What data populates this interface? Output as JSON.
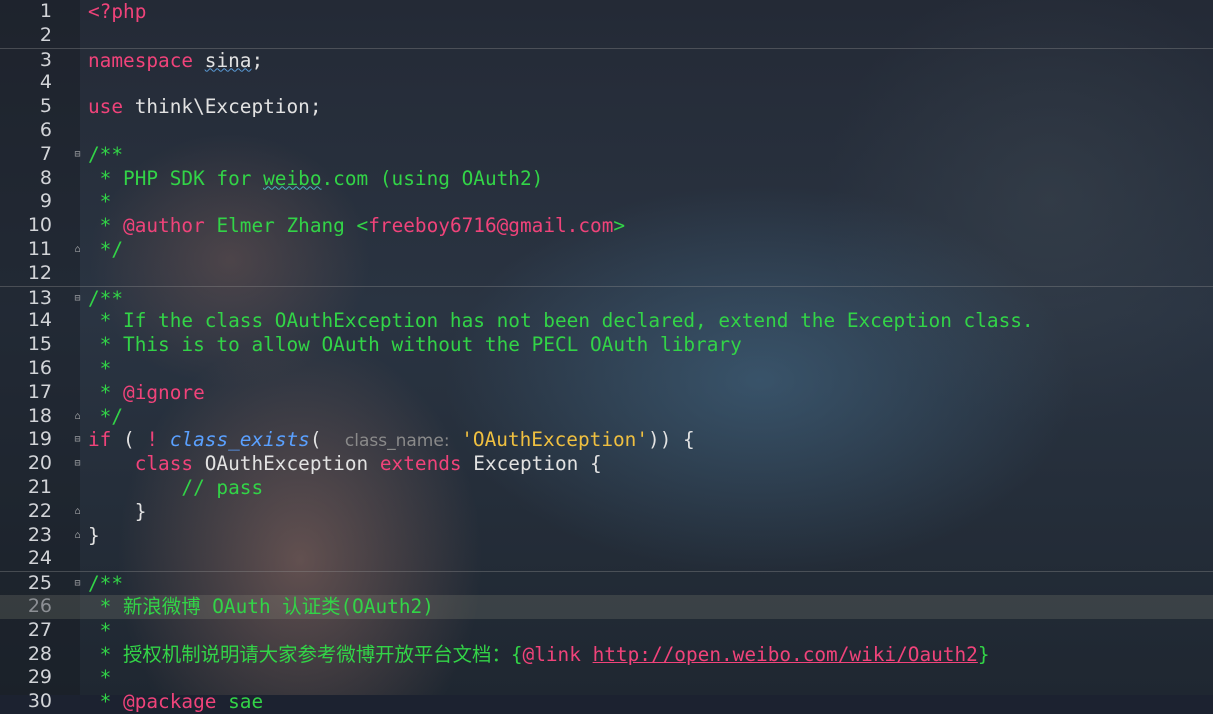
{
  "editor": {
    "line_numbers": [
      "1",
      "2",
      "3",
      "4",
      "5",
      "6",
      "7",
      "8",
      "9",
      "10",
      "11",
      "12",
      "13",
      "14",
      "15",
      "16",
      "17",
      "18",
      "19",
      "20",
      "21",
      "22",
      "23",
      "24",
      "25",
      "26",
      "27",
      "28",
      "29",
      "30"
    ],
    "l1": {
      "open": "<?php"
    },
    "l3": {
      "kw": "namespace",
      "name": "sina",
      "semi": ";"
    },
    "l5": {
      "kw": "use",
      "rest": " think\\Exception;"
    },
    "l7": "/**",
    "l8": {
      "a": " * PHP SDK for ",
      "b": "weibo",
      "c": ".com (using OAuth2)"
    },
    "l9": " *",
    "l10": {
      "star": " * ",
      "tag": "@author",
      "mid": " Elmer Zhang <",
      "email": "freeboy6716@gmail.com",
      "end": ">"
    },
    "l11": " */",
    "l13": "/**",
    "l14": " * If the class OAuthException has not been declared, extend the Exception class.",
    "l15": " * This is to allow OAuth without the PECL OAuth library",
    "l16": " *",
    "l17": {
      "star": " * ",
      "tag": "@ignore"
    },
    "l18": " */",
    "l19": {
      "kw": "if",
      "p1": " ( ",
      "not": "!",
      "sp": " ",
      "fn": "class_exists",
      "open": "(",
      "hint": "class_name:",
      "str": "'OAuthException'",
      "close": ")) {"
    },
    "l20": {
      "indent": "    ",
      "kw": "class",
      "name": " OAuthException ",
      "kw2": "extends",
      "rest": " Exception {"
    },
    "l21": "        // pass",
    "l22": "    }",
    "l23": "}",
    "l25": "/**",
    "l26": " * 新浪微博 OAuth 认证类(OAuth2)",
    "l27": " *",
    "l28": {
      "a": " * 授权机制说明请大家参考微博开放平台文档：{",
      "tag": "@link",
      "sp": " ",
      "url": "http://open.weibo.com/wiki/Oauth2",
      "end": "}"
    },
    "l29": " *",
    "l30": {
      "star": " * ",
      "tag": "@package",
      "rest": " sae"
    }
  },
  "colors": {
    "keyword": "#f0437a",
    "comment": "#32d447",
    "function": "#5aa0ff",
    "string": "#f0c040"
  }
}
